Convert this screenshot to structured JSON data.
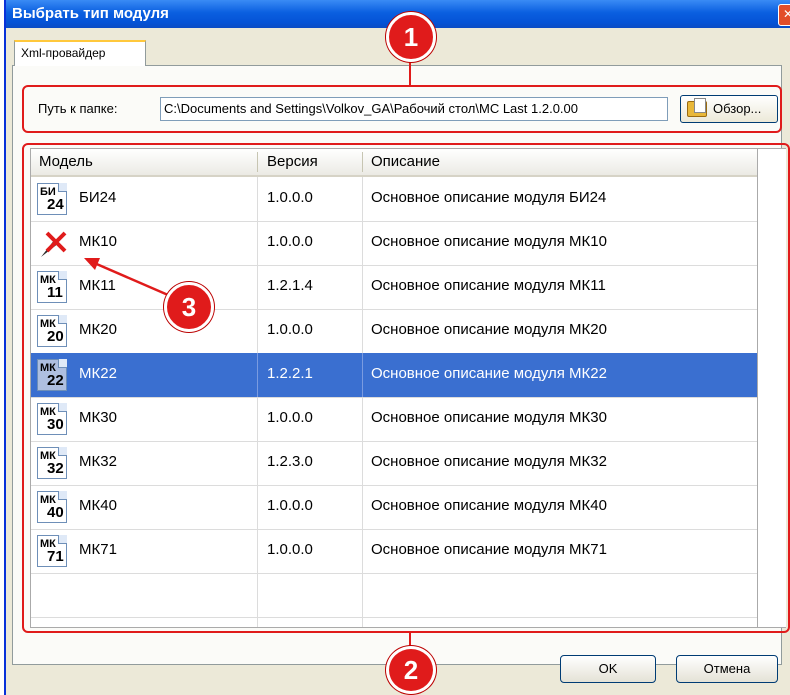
{
  "window": {
    "title": "Выбрать тип модуля",
    "close_glyph": "✕"
  },
  "tab": {
    "label": "Xml-провайдер"
  },
  "path": {
    "label": "Путь к папке:",
    "value": "C:\\Documents and Settings\\Volkov_GA\\Рабочий стол\\MC Last 1.2.0.00",
    "browse_label": "Обзор..."
  },
  "grid": {
    "columns": [
      "Модель",
      "Версия",
      "Описание"
    ],
    "rows": [
      {
        "icon_top": "БИ",
        "icon_num": "24",
        "model": "БИ24",
        "version": "1.0.0.0",
        "description": "Основное описание модуля БИ24"
      },
      {
        "icon_top": "",
        "icon_num": "",
        "model": "МК10",
        "version": "1.0.0.0",
        "description": "Основное описание модуля МК10",
        "icon": "broken-module-icon"
      },
      {
        "icon_top": "МК",
        "icon_num": "11",
        "model": "МК11",
        "version": "1.2.1.4",
        "description": "Основное описание модуля МК11"
      },
      {
        "icon_top": "МК",
        "icon_num": "20",
        "model": "МК20",
        "version": "1.0.0.0",
        "description": "Основное описание модуля МК20"
      },
      {
        "icon_top": "МК",
        "icon_num": "22",
        "model": "МК22",
        "version": "1.2.2.1",
        "description": "Основное описание модуля МК22",
        "selected": true
      },
      {
        "icon_top": "МК",
        "icon_num": "30",
        "model": "МК30",
        "version": "1.0.0.0",
        "description": "Основное описание модуля МК30"
      },
      {
        "icon_top": "МК",
        "icon_num": "32",
        "model": "МК32",
        "version": "1.2.3.0",
        "description": "Основное описание модуля МК32"
      },
      {
        "icon_top": "МК",
        "icon_num": "40",
        "model": "МК40",
        "version": "1.0.0.0",
        "description": "Основное описание модуля МК40"
      },
      {
        "icon_top": "МК",
        "icon_num": "71",
        "model": "МК71",
        "version": "1.0.0.0",
        "description": "Основное описание модуля МК71"
      }
    ]
  },
  "buttons": {
    "ok": "OK",
    "cancel": "Отмена"
  },
  "callouts": {
    "one": "1",
    "two": "2",
    "three": "3"
  },
  "colors": {
    "callout": "#e01b1b",
    "selection": "#3a6fd0",
    "title_bar": "#0a5fe0"
  }
}
